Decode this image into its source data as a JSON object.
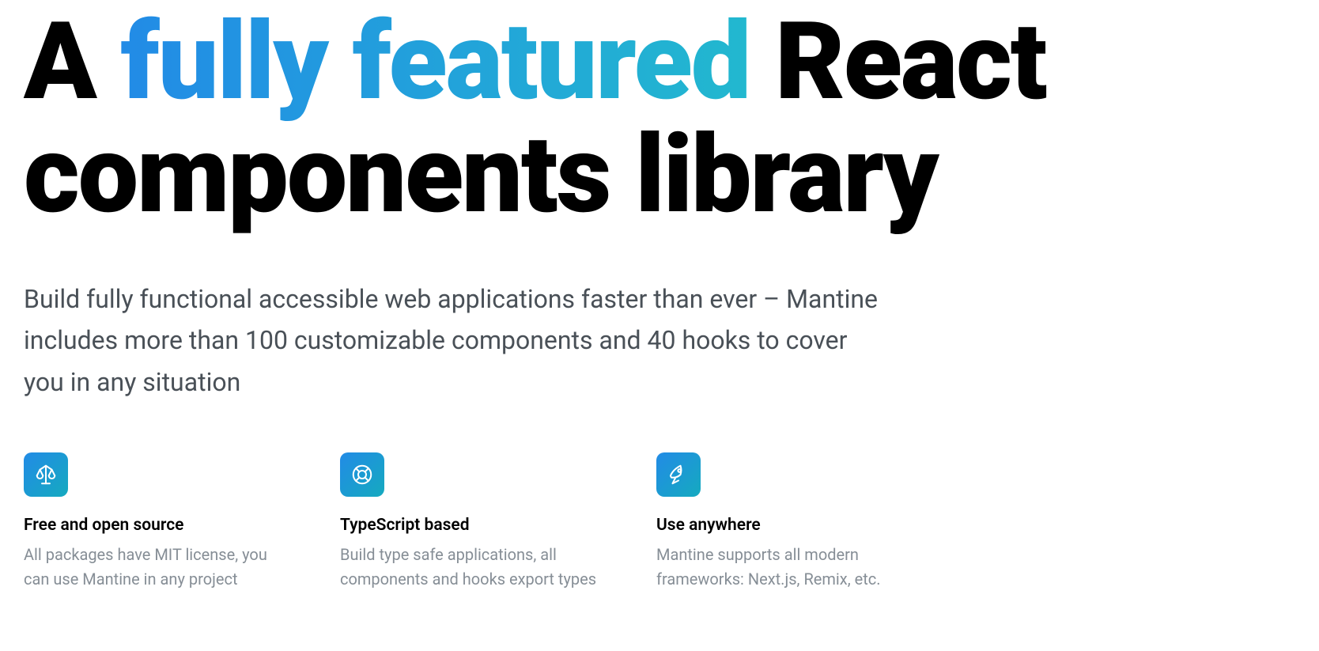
{
  "hero": {
    "title_before": "A ",
    "title_highlight": "fully featured",
    "title_after": " React components library",
    "description": "Build fully functional accessible web applications faster than ever – Mantine includes more than 100 customizable components and 40 hooks to cover you in any situation"
  },
  "features": [
    {
      "icon": "scale-icon",
      "title": "Free and open source",
      "description": "All packages have MIT license, you can use Mantine in any project"
    },
    {
      "icon": "lifebuoy-icon",
      "title": "TypeScript based",
      "description": "Build type safe applications, all components and hooks export types"
    },
    {
      "icon": "rocket-icon",
      "title": "Use anywhere",
      "description": "Mantine supports all modern frameworks: Next.js, Remix, etc."
    }
  ]
}
